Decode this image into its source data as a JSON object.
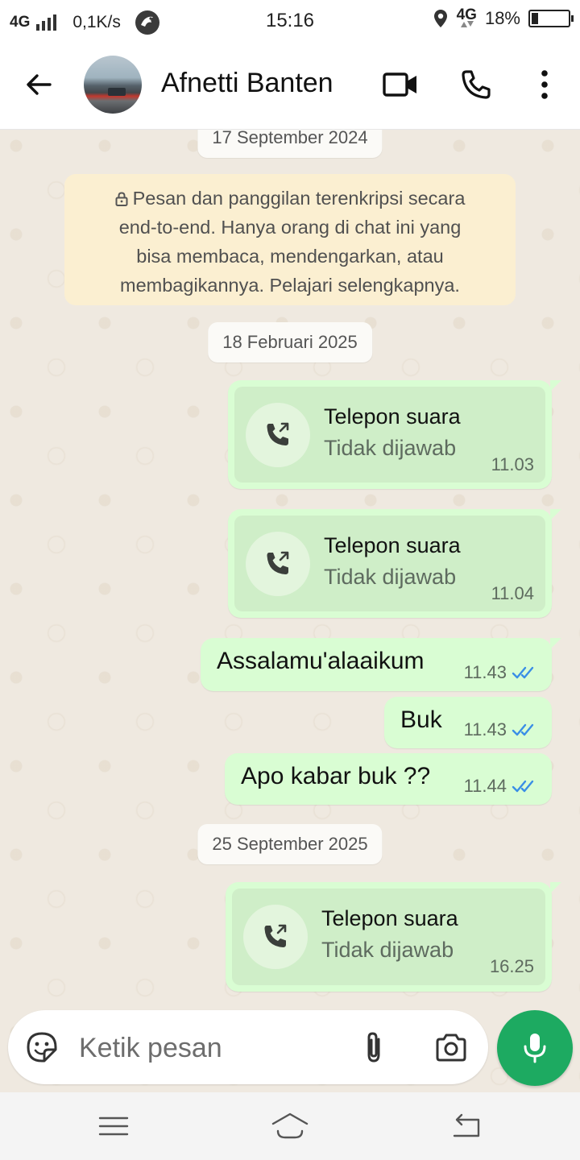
{
  "status_bar": {
    "network_left": "4G",
    "speed": "0,1K/s",
    "time": "15:16",
    "network_right": "4G",
    "battery": "18%",
    "battery_level": 0.18,
    "icons": [
      "signal-icon",
      "bird-app-icon",
      "location-icon",
      "data-arrows-icon",
      "battery-icon"
    ]
  },
  "header": {
    "contact_name": "Afnetti Banten",
    "icons": [
      "back-arrow-icon",
      "video-call-icon",
      "voice-call-icon",
      "more-vert-icon"
    ]
  },
  "chat": {
    "date_chips": [
      "17 September 2024",
      "18 Februari 2025",
      "25 September 2025"
    ],
    "encryption_notice": {
      "lines": [
        "Pesan dan panggilan terenkripsi secara",
        "end-to-end. Hanya orang di chat ini yang",
        "bisa membaca, mendengarkan, atau",
        "membagikannya. Pelajari selengkapnya."
      ]
    },
    "messages": [
      {
        "type": "call",
        "title": "Telepon suara",
        "status": "Tidak dijawab",
        "time": "11.03"
      },
      {
        "type": "call",
        "title": "Telepon suara",
        "status": "Tidak dijawab",
        "time": "11.04"
      },
      {
        "type": "text",
        "text": "Assalamu'alaaikum",
        "time": "11.43",
        "read": true
      },
      {
        "type": "text",
        "text": "Buk",
        "time": "11.43",
        "read": true
      },
      {
        "type": "text",
        "text": "Apo kabar buk ??",
        "time": "11.44",
        "read": true
      },
      {
        "type": "call",
        "title": "Telepon suara",
        "status": "Tidak dijawab",
        "time": "16.25"
      }
    ],
    "colors": {
      "bubble": "#d9fdd3",
      "call_inner": "#cfeec8",
      "read_ticks": "#3a8ee6",
      "background": "#efe9e0"
    }
  },
  "composer": {
    "placeholder": "Ketik pesan",
    "value": "",
    "icons": [
      "sticker-icon",
      "attach-icon",
      "camera-icon",
      "mic-icon"
    ],
    "mic_color": "#1daa61"
  },
  "nav_bar": {
    "icons": [
      "recent-apps-icon",
      "home-icon",
      "back-icon"
    ]
  }
}
